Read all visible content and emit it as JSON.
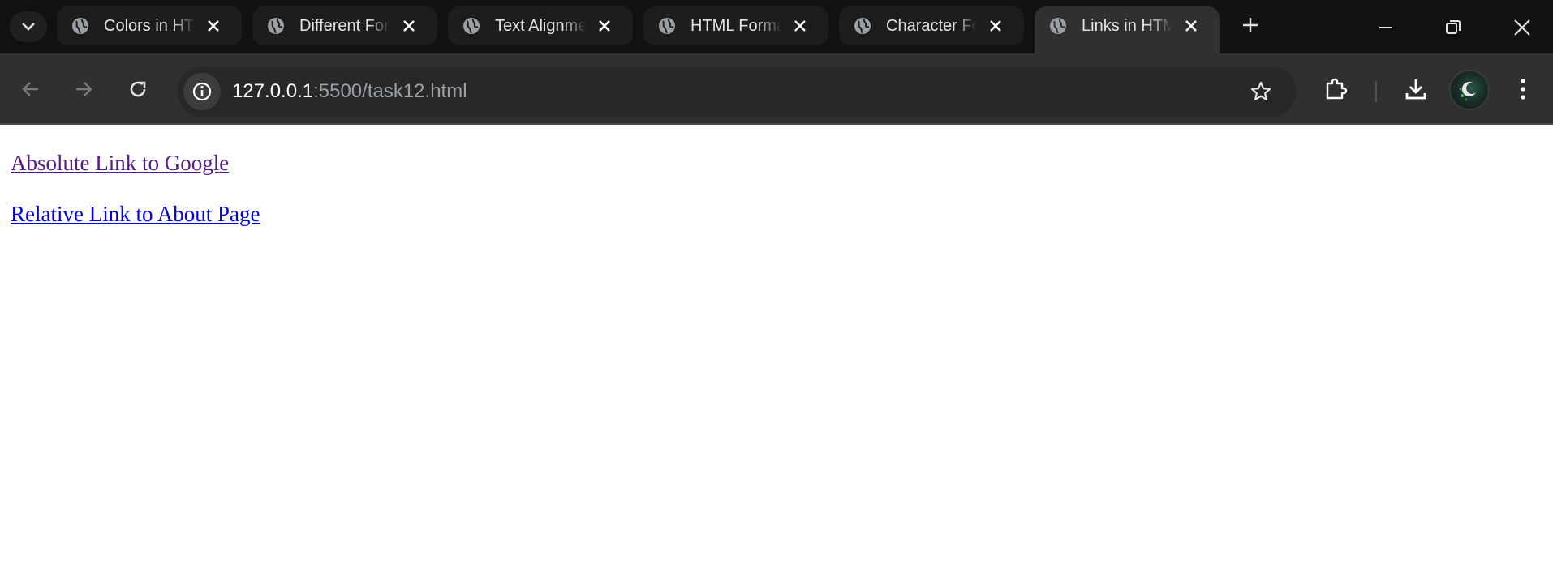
{
  "browser": {
    "tabs": [
      {
        "title": "Colors in HT"
      },
      {
        "title": "Different For"
      },
      {
        "title": "Text Alignme"
      },
      {
        "title": "HTML Forma"
      },
      {
        "title": "Character Fo"
      },
      {
        "title": "Links in HTM",
        "active": true
      }
    ],
    "url_host": "127.0.0.1",
    "url_rest": ":5500/task12.html"
  },
  "page": {
    "links": [
      {
        "text": "Absolute Link to Google",
        "state": "visited",
        "color": "#551a8b"
      },
      {
        "text": "Relative Link to About Page",
        "state": "unvisited",
        "color": "#0000ee"
      }
    ]
  }
}
